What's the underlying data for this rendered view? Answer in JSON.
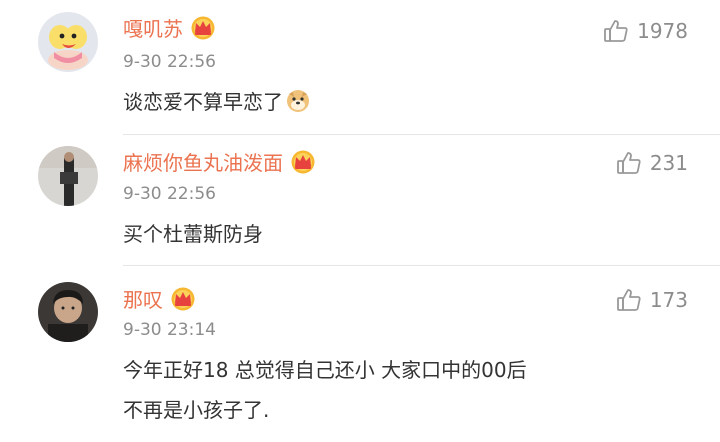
{
  "comments": [
    {
      "username": "嘎叽苏",
      "time": "9-30 22:56",
      "likes": "1978",
      "text_lines": [
        "谈恋爱不算早恋了"
      ],
      "emoji": "doge-emoji",
      "badge": "vip-crown-icon"
    },
    {
      "username": "麻烦你鱼丸油泼面",
      "time": "9-30 22:56",
      "likes": "231",
      "text_lines": [
        "买个杜蕾斯防身"
      ],
      "badge": "vip-crown-icon"
    },
    {
      "username": "那叹",
      "time": "9-30 23:14",
      "likes": "173",
      "text_lines": [
        "今年正好18 总觉得自己还小 大家口中的00后",
        "不再是小孩子了."
      ],
      "badge": "vip-crown-icon"
    }
  ],
  "colors": {
    "username": "#eb7350",
    "meta": "#8c8c8c",
    "text": "#333333",
    "divider": "#e6e6e6"
  }
}
